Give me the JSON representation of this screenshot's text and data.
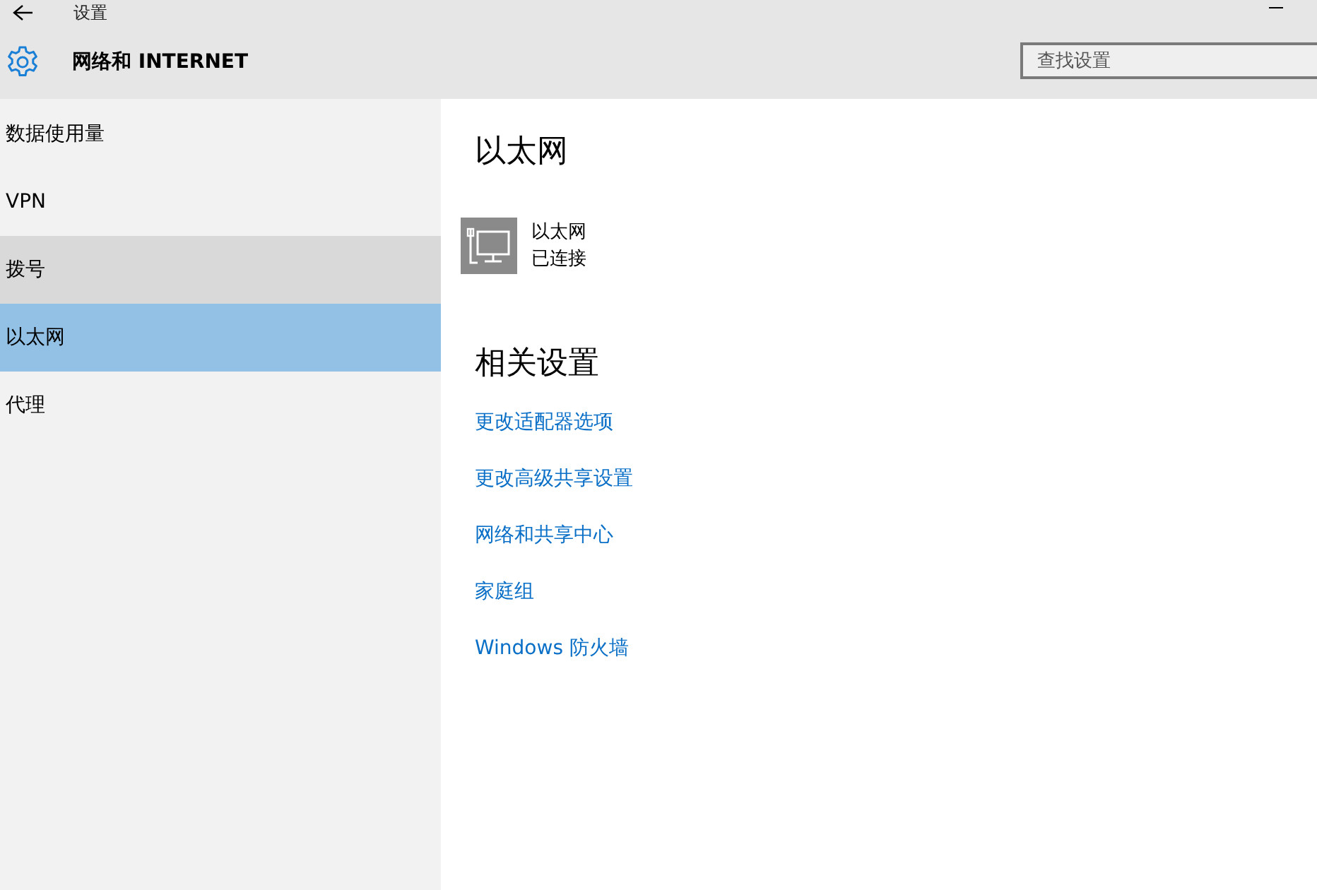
{
  "window": {
    "title": "设置"
  },
  "header": {
    "title": "网络和 INTERNET",
    "search": {
      "placeholder": "查找设置"
    }
  },
  "sidebar": {
    "items": [
      {
        "label": "数据使用量",
        "selected": false,
        "hovered": false
      },
      {
        "label": "VPN",
        "selected": false,
        "hovered": false
      },
      {
        "label": "拨号",
        "selected": false,
        "hovered": true
      },
      {
        "label": "以太网",
        "selected": true,
        "hovered": false
      },
      {
        "label": "代理",
        "selected": false,
        "hovered": false
      }
    ]
  },
  "main": {
    "title": "以太网",
    "connection": {
      "name": "以太网",
      "status": "已连接"
    },
    "related": {
      "heading": "相关设置",
      "links": [
        "更改适配器选项",
        "更改高级共享设置",
        "网络和共享中心",
        "家庭组",
        "Windows 防火墙"
      ]
    }
  }
}
